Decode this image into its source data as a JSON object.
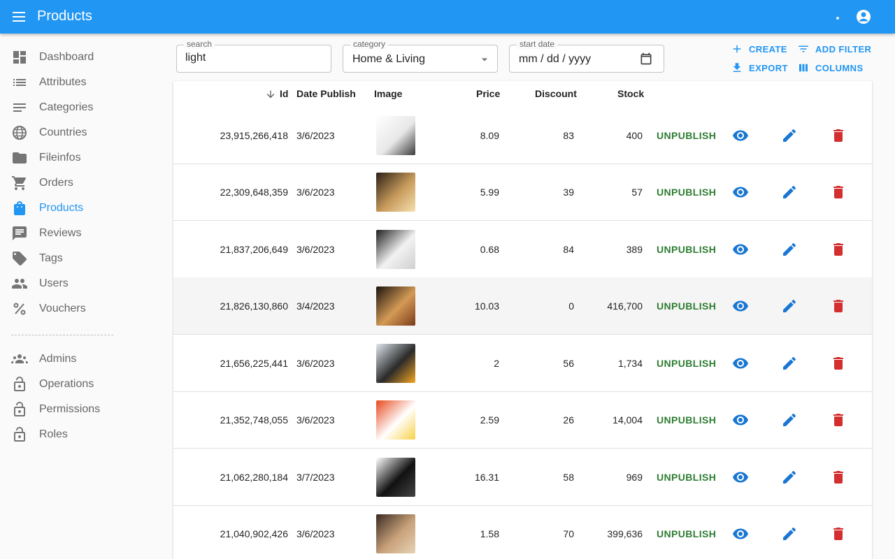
{
  "appbar": {
    "title": "Products",
    "bg": "#2196f3"
  },
  "sidebar": {
    "items": [
      {
        "label": "Dashboard",
        "icon": "dashboard-icon"
      },
      {
        "label": "Attributes",
        "icon": "list-icon"
      },
      {
        "label": "Categories",
        "icon": "sort-icon"
      },
      {
        "label": "Countries",
        "icon": "globe-icon"
      },
      {
        "label": "Fileinfos",
        "icon": "folder-icon"
      },
      {
        "label": "Orders",
        "icon": "cart-icon"
      },
      {
        "label": "Products",
        "icon": "shopping-bag-icon",
        "active": true
      },
      {
        "label": "Reviews",
        "icon": "comment-icon"
      },
      {
        "label": "Tags",
        "icon": "tag-icon"
      },
      {
        "label": "Users",
        "icon": "people-icon"
      },
      {
        "label": "Vouchers",
        "icon": "percent-icon"
      }
    ],
    "admin_items": [
      {
        "label": "Admins",
        "icon": "groups-icon"
      },
      {
        "label": "Operations",
        "icon": "lock-open-icon"
      },
      {
        "label": "Permissions",
        "icon": "lock-open-icon"
      },
      {
        "label": "Roles",
        "icon": "lock-open-icon"
      }
    ]
  },
  "filters": {
    "search": {
      "label": "search",
      "value": "light"
    },
    "category": {
      "label": "category",
      "value": "Home & Living"
    },
    "start_date": {
      "label": "start date",
      "value": "mm / dd / yyyy"
    }
  },
  "toolbar": {
    "create": "CREATE",
    "add_filter": "ADD FILTER",
    "export": "EXPORT",
    "columns": "COLUMNS"
  },
  "table": {
    "headers": {
      "id": "Id",
      "date": "Date Publish",
      "image": "Image",
      "price": "Price",
      "discount": "Discount",
      "stock": "Stock"
    },
    "rows": [
      {
        "id": "23,915,266,418",
        "date": "3/6/2023",
        "price": "8.09",
        "discount": "83",
        "stock": "400",
        "status": "UNPUBLISH"
      },
      {
        "id": "22,309,648,359",
        "date": "3/6/2023",
        "price": "5.99",
        "discount": "39",
        "stock": "57",
        "status": "UNPUBLISH"
      },
      {
        "id": "21,837,206,649",
        "date": "3/6/2023",
        "price": "0.68",
        "discount": "84",
        "stock": "389",
        "status": "UNPUBLISH"
      },
      {
        "id": "21,826,130,860",
        "date": "3/4/2023",
        "price": "10.03",
        "discount": "0",
        "stock": "416,700",
        "status": "UNPUBLISH"
      },
      {
        "id": "21,656,225,441",
        "date": "3/6/2023",
        "price": "2",
        "discount": "56",
        "stock": "1,734",
        "status": "UNPUBLISH"
      },
      {
        "id": "21,352,748,055",
        "date": "3/6/2023",
        "price": "2.59",
        "discount": "26",
        "stock": "14,004",
        "status": "UNPUBLISH"
      },
      {
        "id": "21,062,280,184",
        "date": "3/7/2023",
        "price": "16.31",
        "discount": "58",
        "stock": "969",
        "status": "UNPUBLISH"
      },
      {
        "id": "21,040,902,426",
        "date": "3/6/2023",
        "price": "1.58",
        "discount": "70",
        "stock": "399,636",
        "status": "UNPUBLISH"
      }
    ]
  },
  "colors": {
    "primary": "#2196f3",
    "status": "#2e7d32",
    "delete": "#d32f2f",
    "action": "#1976d2"
  }
}
